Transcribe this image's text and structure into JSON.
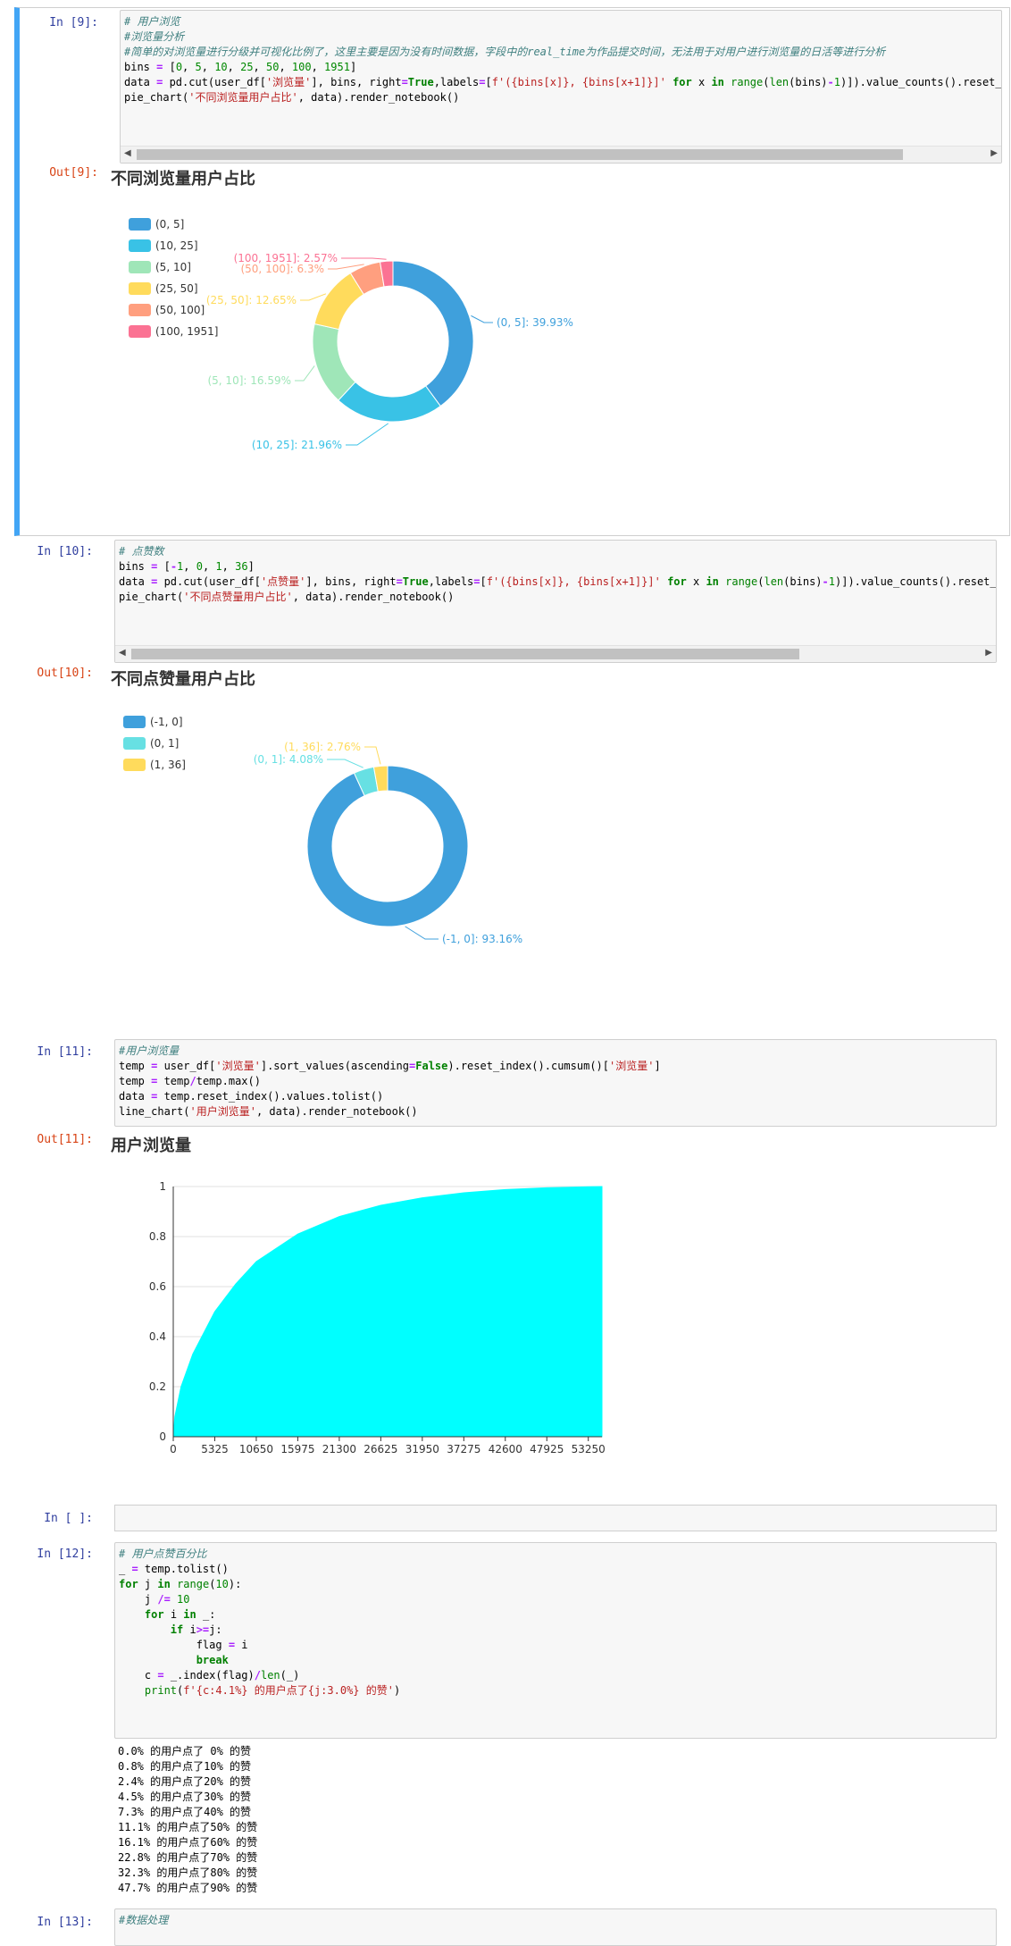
{
  "cells": {
    "c9": {
      "in_prompt": "In  [9]:",
      "out_prompt": "Out[9]:",
      "chart_title": "不同浏览量用户占比"
    },
    "c10": {
      "in_prompt": "In  [10]:",
      "out_prompt": "Out[10]:",
      "chart_title": "不同点赞量用户占比"
    },
    "c11": {
      "in_prompt": "In  [11]:",
      "out_prompt": "Out[11]:",
      "chart_title": "用户浏览量"
    },
    "cempty": {
      "in_prompt": "In  [ ]:"
    },
    "c12": {
      "in_prompt": "In  [12]:",
      "output_lines": [
        "0.0% 的用户点了 0% 的赞",
        "0.8% 的用户点了10% 的赞",
        "2.4% 的用户点了20% 的赞",
        "4.5% 的用户点了30% 的赞",
        "7.3% 的用户点了40% 的赞",
        "11.1% 的用户点了50% 的赞",
        "16.1% 的用户点了60% 的赞",
        "22.8% 的用户点了70% 的赞",
        "32.3% 的用户点了80% 的赞",
        "47.7% 的用户点了90% 的赞"
      ]
    },
    "c13": {
      "in_prompt": "In  [13]:",
      "first_line": "#数据处理"
    }
  },
  "code": {
    "c9": [
      [
        [
          "cm",
          "# 用户浏览"
        ]
      ],
      [
        [
          "cm",
          "#浏览量分析"
        ]
      ],
      [
        [
          "cm",
          "#简单的对浏览量进行分级并可视化比例了，这里主要是因为没有时间数据，字段中的real_time为作品提交时间，无法用于对用户进行浏览量的日活等进行分析"
        ]
      ],
      [
        [
          "t",
          "bins "
        ],
        [
          "op",
          "="
        ],
        [
          "t",
          " ["
        ],
        [
          "num",
          "0"
        ],
        [
          "t",
          ", "
        ],
        [
          "num",
          "5"
        ],
        [
          "t",
          ", "
        ],
        [
          "num",
          "10"
        ],
        [
          "t",
          ", "
        ],
        [
          "num",
          "25"
        ],
        [
          "t",
          ", "
        ],
        [
          "num",
          "50"
        ],
        [
          "t",
          ", "
        ],
        [
          "num",
          "100"
        ],
        [
          "t",
          ", "
        ],
        [
          "num",
          "1951"
        ],
        [
          "t",
          "]"
        ]
      ],
      [
        [
          "t",
          "data "
        ],
        [
          "op",
          "="
        ],
        [
          "t",
          " pd.cut(user_df["
        ],
        [
          "str",
          "'浏览量'"
        ],
        [
          "t",
          "], bins, right"
        ],
        [
          "op",
          "="
        ],
        [
          "kw",
          "True"
        ],
        [
          "t",
          ",labels"
        ],
        [
          "op",
          "="
        ],
        [
          "t",
          "["
        ],
        [
          "str",
          "f'({bins[x]}, {bins[x+1]}]'"
        ],
        [
          "t",
          " "
        ],
        [
          "kw",
          "for"
        ],
        [
          "t",
          " x "
        ],
        [
          "kw",
          "in"
        ],
        [
          "t",
          " "
        ],
        [
          "bi",
          "range"
        ],
        [
          "t",
          "("
        ],
        [
          "bi",
          "len"
        ],
        [
          "t",
          "(bins)"
        ],
        [
          "op",
          "-"
        ],
        [
          "num",
          "1"
        ],
        [
          "t",
          ")]).value_counts().reset_inde"
        ]
      ],
      [
        [
          "t",
          "pie_chart("
        ],
        [
          "str",
          "'不同浏览量用户占比'"
        ],
        [
          "t",
          ", data).render_notebook()"
        ]
      ]
    ],
    "c10": [
      [
        [
          "cm",
          "# 点赞数"
        ]
      ],
      [
        [
          "t",
          "bins "
        ],
        [
          "op",
          "="
        ],
        [
          "t",
          " ["
        ],
        [
          "op",
          "-"
        ],
        [
          "num",
          "1"
        ],
        [
          "t",
          ", "
        ],
        [
          "num",
          "0"
        ],
        [
          "t",
          ", "
        ],
        [
          "num",
          "1"
        ],
        [
          "t",
          ", "
        ],
        [
          "num",
          "36"
        ],
        [
          "t",
          "]"
        ]
      ],
      [
        [
          "t",
          "data "
        ],
        [
          "op",
          "="
        ],
        [
          "t",
          " pd.cut(user_df["
        ],
        [
          "str",
          "'点赞量'"
        ],
        [
          "t",
          "], bins, right"
        ],
        [
          "op",
          "="
        ],
        [
          "kw",
          "True"
        ],
        [
          "t",
          ",labels"
        ],
        [
          "op",
          "="
        ],
        [
          "t",
          "["
        ],
        [
          "str",
          "f'({bins[x]}, {bins[x+1]}]'"
        ],
        [
          "t",
          " "
        ],
        [
          "kw",
          "for"
        ],
        [
          "t",
          " x "
        ],
        [
          "kw",
          "in"
        ],
        [
          "t",
          " "
        ],
        [
          "bi",
          "range"
        ],
        [
          "t",
          "("
        ],
        [
          "bi",
          "len"
        ],
        [
          "t",
          "(bins)"
        ],
        [
          "op",
          "-"
        ],
        [
          "num",
          "1"
        ],
        [
          "t",
          ")]).value_counts().reset_inde"
        ]
      ],
      [
        [
          "t",
          "pie_chart("
        ],
        [
          "str",
          "'不同点赞量用户占比'"
        ],
        [
          "t",
          ", data).render_notebook()"
        ]
      ]
    ],
    "c11": [
      [
        [
          "cm",
          "#用户浏览量"
        ]
      ],
      [
        [
          "t",
          "temp "
        ],
        [
          "op",
          "="
        ],
        [
          "t",
          " user_df["
        ],
        [
          "str",
          "'浏览量'"
        ],
        [
          "t",
          "].sort_values(ascending"
        ],
        [
          "op",
          "="
        ],
        [
          "kw",
          "False"
        ],
        [
          "t",
          ").reset_index().cumsum()["
        ],
        [
          "str",
          "'浏览量'"
        ],
        [
          "t",
          "]"
        ]
      ],
      [
        [
          "t",
          "temp "
        ],
        [
          "op",
          "="
        ],
        [
          "t",
          " temp"
        ],
        [
          "op",
          "/"
        ],
        [
          "t",
          "temp.max()"
        ]
      ],
      [
        [
          "t",
          "data "
        ],
        [
          "op",
          "="
        ],
        [
          "t",
          " temp.reset_index().values.tolist()"
        ]
      ],
      [
        [
          "t",
          "line_chart("
        ],
        [
          "str",
          "'用户浏览量'"
        ],
        [
          "t",
          ", data).render_notebook()"
        ]
      ]
    ],
    "c12": [
      [
        [
          "cm",
          "# 用户点赞百分比"
        ]
      ],
      [
        [
          "t",
          "_ "
        ],
        [
          "op",
          "="
        ],
        [
          "t",
          " temp.tolist()"
        ]
      ],
      [
        [
          "kw",
          "for"
        ],
        [
          "t",
          " j "
        ],
        [
          "kw",
          "in"
        ],
        [
          "t",
          " "
        ],
        [
          "bi",
          "range"
        ],
        [
          "t",
          "("
        ],
        [
          "num",
          "10"
        ],
        [
          "t",
          "):"
        ]
      ],
      [
        [
          "t",
          "    j "
        ],
        [
          "op",
          "/="
        ],
        [
          "t",
          " "
        ],
        [
          "num",
          "10"
        ]
      ],
      [
        [
          "t",
          "    "
        ],
        [
          "kw",
          "for"
        ],
        [
          "t",
          " i "
        ],
        [
          "kw",
          "in"
        ],
        [
          "t",
          " _:"
        ]
      ],
      [
        [
          "t",
          "        "
        ],
        [
          "kw",
          "if"
        ],
        [
          "t",
          " i"
        ],
        [
          "op",
          ">="
        ],
        [
          "t",
          "j:"
        ]
      ],
      [
        [
          "t",
          "            flag "
        ],
        [
          "op",
          "="
        ],
        [
          "t",
          " i"
        ]
      ],
      [
        [
          "t",
          "            "
        ],
        [
          "kw",
          "break"
        ]
      ],
      [
        [
          "t",
          "    c "
        ],
        [
          "op",
          "="
        ],
        [
          "t",
          " _.index(flag)"
        ],
        [
          "op",
          "/"
        ],
        [
          "bi",
          "len"
        ],
        [
          "t",
          "(_)"
        ]
      ],
      [
        [
          "t",
          "    "
        ],
        [
          "bi",
          "print"
        ],
        [
          "t",
          "("
        ],
        [
          "str",
          "f'{c:4.1%} 的用户点了{j:3.0%} 的赞'"
        ],
        [
          "t",
          ")"
        ]
      ]
    ]
  },
  "chart_data": [
    {
      "type": "pie",
      "title": "不同浏览量用户占比",
      "legend_position": "left",
      "categories": [
        "(0, 5]",
        "(10, 25]",
        "(5, 10]",
        "(25, 50]",
        "(50, 100]",
        "(100, 1951]"
      ],
      "values": [
        39.93,
        21.96,
        16.59,
        12.65,
        6.3,
        2.57
      ],
      "slice_labels": [
        "(0, 5]: 39.93%",
        "(10, 25]: 21.96%",
        "(5, 10]: 16.59%",
        "(25, 50]: 12.65%",
        "(50, 100]: 6.3%",
        "(100, 1951]: 2.57%"
      ],
      "legend": [
        "(0, 5]",
        "(10, 25]",
        "(5, 10]",
        "(25, 50]",
        "(50, 100]",
        "(100, 1951]"
      ],
      "colors": [
        "#3fa0dc",
        "#39c2e6",
        "#9fe6b8",
        "#ffdb5c",
        "#ff9f7f",
        "#fb7293"
      ]
    },
    {
      "type": "pie",
      "title": "不同点赞量用户占比",
      "legend_position": "left",
      "categories": [
        "(-1, 0]",
        "(0, 1]",
        "(1, 36]"
      ],
      "values": [
        93.16,
        4.08,
        2.76
      ],
      "slice_labels": [
        "(-1, 0]: 93.16%",
        "(0, 1]: 4.08%",
        "(1, 36]: 2.76%"
      ],
      "legend": [
        "(-1, 0]",
        "(0, 1]",
        "(1, 36]"
      ],
      "colors": [
        "#3fa0dc",
        "#67e0e3",
        "#ffdb5c"
      ]
    },
    {
      "type": "area",
      "title": "用户浏览量",
      "x_ticks": [
        "0",
        "5325",
        "10650",
        "15975",
        "21300",
        "26625",
        "31950",
        "37275",
        "42600",
        "47925",
        "53250"
      ],
      "y_ticks": [
        "0",
        "0.2",
        "0.4",
        "0.6",
        "0.8",
        "1"
      ],
      "xlim": [
        0,
        55000
      ],
      "ylim": [
        0,
        1
      ],
      "x": [
        0,
        200,
        1000,
        2500,
        5325,
        8000,
        10650,
        15975,
        21300,
        26625,
        31950,
        37275,
        42600,
        47925,
        53250,
        55000
      ],
      "y": [
        0,
        0.08,
        0.2,
        0.33,
        0.5,
        0.61,
        0.7,
        0.81,
        0.88,
        0.925,
        0.955,
        0.975,
        0.988,
        0.995,
        0.999,
        1
      ],
      "fill_color": "#00ffff",
      "grid": true
    }
  ]
}
